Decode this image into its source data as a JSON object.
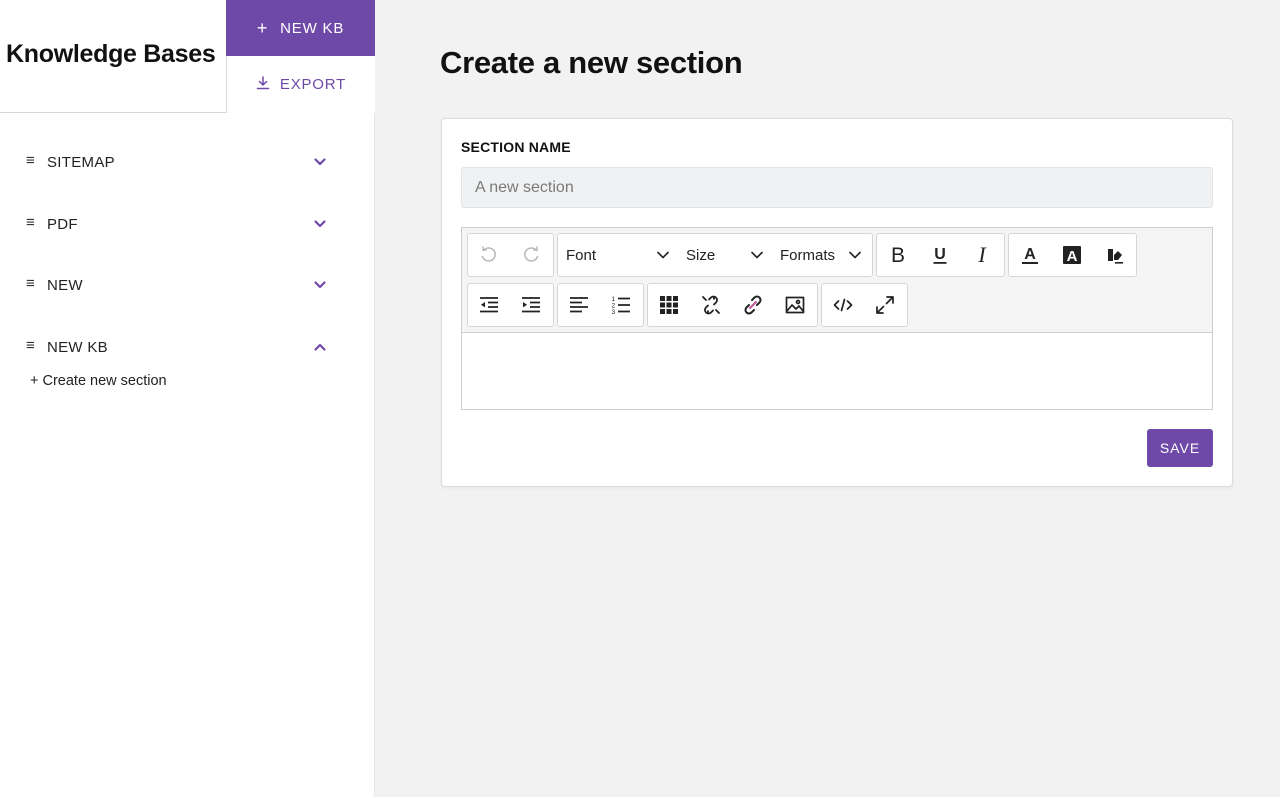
{
  "sidebar": {
    "title": "Knowledge Bases",
    "new_kb_label": "NEW KB",
    "export_label": "EXPORT",
    "items": [
      {
        "label": "SITEMAP",
        "expanded": false
      },
      {
        "label": "PDF",
        "expanded": false
      },
      {
        "label": "NEW",
        "expanded": false
      },
      {
        "label": "NEW KB",
        "expanded": true
      }
    ],
    "create_section_label": "+ Create new section"
  },
  "main": {
    "title": "Create a new section",
    "section_name_label": "SECTION NAME",
    "section_name_placeholder": "A new section",
    "toolbar": {
      "font_label": "Font",
      "size_label": "Size",
      "formats_label": "Formats"
    },
    "save_label": "SAVE"
  },
  "colors": {
    "accent": "#6f49a8",
    "page_bg": "#f2f2f3"
  }
}
